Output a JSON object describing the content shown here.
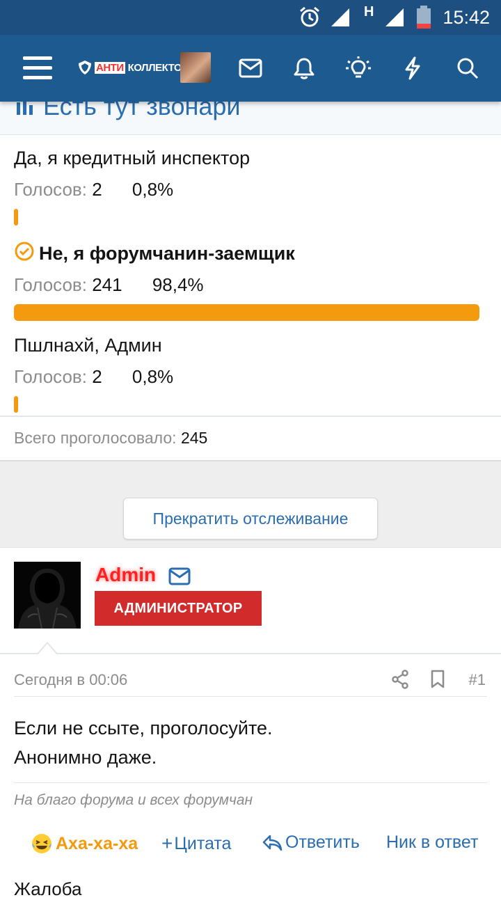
{
  "status_bar": {
    "time": "15:42",
    "network_type": "H",
    "icons": [
      "alarm-icon",
      "signal-icon",
      "signal-icon",
      "battery-low-icon"
    ]
  },
  "app_bar": {
    "logo_red": "АНТИ",
    "logo_white": "КОЛЛЕКТОР",
    "icons": [
      "menu-icon",
      "mail-icon",
      "bell-icon",
      "bulb-icon",
      "lightning-icon",
      "search-icon"
    ]
  },
  "poll": {
    "title": "Есть тут звонари",
    "votes_label": "Голосов:",
    "options": [
      {
        "label": "Да, я кредитный инспектор",
        "votes": "2",
        "percent": "0,8%",
        "fraction": 0.008,
        "selected": false
      },
      {
        "label": "Не, я форумчанин-заемщик",
        "votes": "241",
        "percent": "98,4%",
        "fraction": 0.984,
        "selected": true
      },
      {
        "label": "Пшлнахй, Админ",
        "votes": "2",
        "percent": "0,8%",
        "fraction": 0.008,
        "selected": false
      }
    ],
    "total_label": "Всего проголосовало:",
    "total_value": "245"
  },
  "unwatch_button": "Прекратить отслеживание",
  "post": {
    "author": "Admin",
    "role": "АДМИНИСТРАТОР",
    "date": "Сегодня в 00:06",
    "number": "#1",
    "body_line1": "Если не ссыте, проголосуйте.",
    "body_line2": "Анонимно даже.",
    "signature": "На благо форума и всех форумчан",
    "actions": {
      "reaction": "Аха-ха-ха",
      "quote": "Цитата",
      "reply": "Ответить",
      "mention": "Ник в ответ"
    },
    "cut_text": "Жалоба"
  },
  "colors": {
    "appbar": "#1d5a8f",
    "accent_blue": "#2a6db0",
    "bar_orange": "#f39a0e",
    "admin_red": "#d22b2b"
  }
}
